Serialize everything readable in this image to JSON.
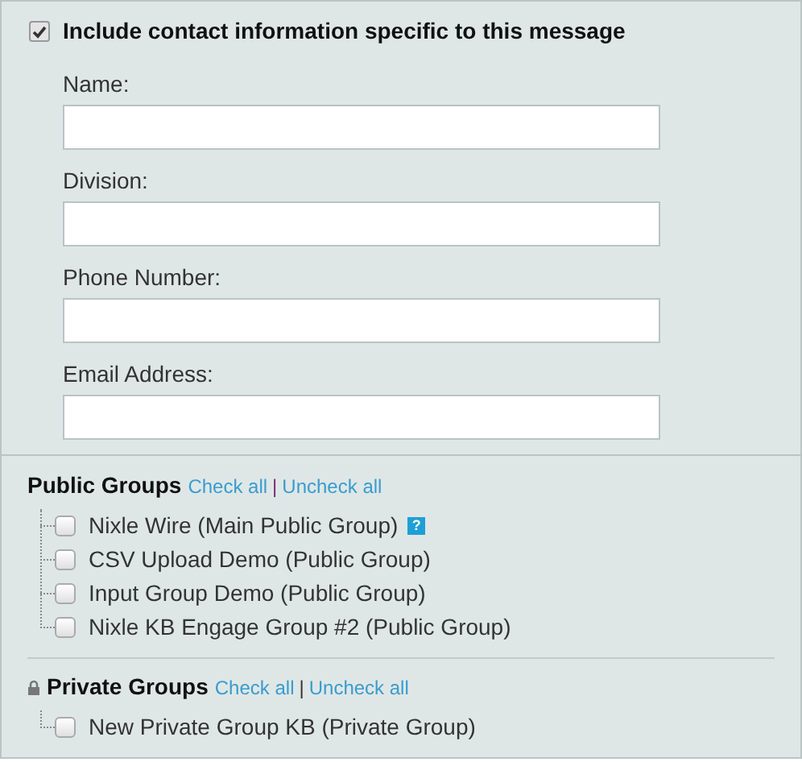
{
  "contact": {
    "checked": true,
    "label": "Include contact information specific to this message",
    "fields": [
      {
        "label": "Name:"
      },
      {
        "label": "Division:"
      },
      {
        "label": "Phone Number:"
      },
      {
        "label": "Email Address:"
      }
    ]
  },
  "groups": [
    {
      "title": "Public Groups",
      "locked": false,
      "check_all": "Check all",
      "separator": "|",
      "uncheck_all": "Uncheck all",
      "items": [
        {
          "label": "Nixle Wire (Main Public Group)",
          "checked": false,
          "help": "?"
        },
        {
          "label": "CSV Upload Demo (Public Group)",
          "checked": false
        },
        {
          "label": "Input Group Demo (Public Group)",
          "checked": false
        },
        {
          "label": "Nixle KB Engage Group #2 (Public Group)",
          "checked": false
        }
      ]
    },
    {
      "title": "Private Groups",
      "locked": true,
      "check_all": "Check all",
      "separator": "|",
      "uncheck_all": "Uncheck all",
      "items": [
        {
          "label": "New Private Group KB (Private Group)",
          "checked": false
        }
      ]
    }
  ]
}
